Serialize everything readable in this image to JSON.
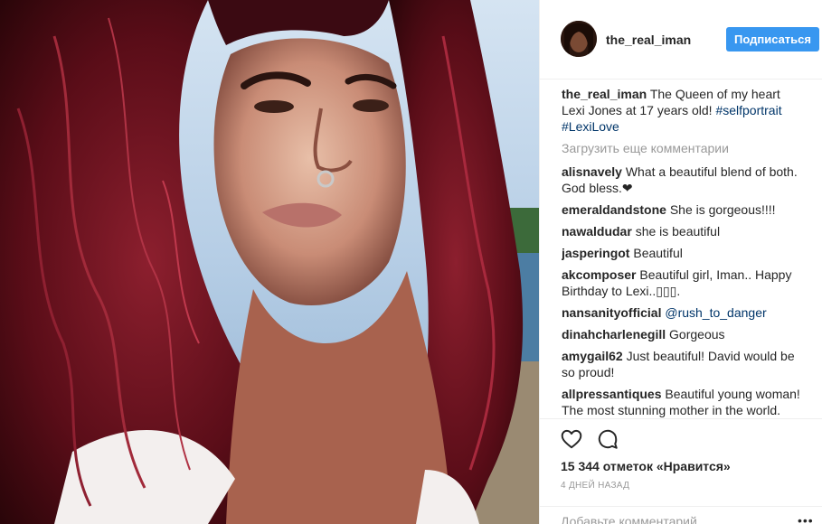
{
  "post": {
    "username": "the_real_iman",
    "follow_label": "Подписаться",
    "caption": {
      "username": "the_real_iman",
      "text": "The Queen of my heart Lexi Jones at 17 years old!",
      "hashtags": [
        "#selfportrait",
        "#LexiLove"
      ]
    },
    "load_more_label": "Загрузить еще комментарии",
    "comments": [
      {
        "username": "alisnavely",
        "text": "What a beautiful blend of both. God bless.❤"
      },
      {
        "username": "emeraldandstone",
        "text": "She is gorgeous!!!!"
      },
      {
        "username": "nawaldudar",
        "text": "she is beautiful"
      },
      {
        "username": "jasperingot",
        "text": "Beautiful"
      },
      {
        "username": "akcomposer",
        "text": "Beautiful girl, Iman.. Happy Birthday to Lexi..▯▯▯."
      },
      {
        "username": "nansanityofficial",
        "text": "@rush_to_danger"
      },
      {
        "username": "dinahcharlenegill",
        "text": "Gorgeous"
      },
      {
        "username": "amygail62",
        "text": "Just beautiful! David would be so proud!"
      },
      {
        "username": "allpressantiques",
        "text": "Beautiful young woman! The most stunning mother in the world."
      }
    ],
    "likes_label": "15 344 отметок «Нравится»",
    "time_label": "4 ДНЕЙ НАЗАД",
    "add_comment_placeholder": "Добавьте комментарий...",
    "more_label": "•••"
  },
  "icons": {
    "like": "heart-icon",
    "comment": "comment-icon"
  },
  "colors": {
    "accent": "#3897f0",
    "hashtag": "#003569",
    "muted": "#999999"
  }
}
